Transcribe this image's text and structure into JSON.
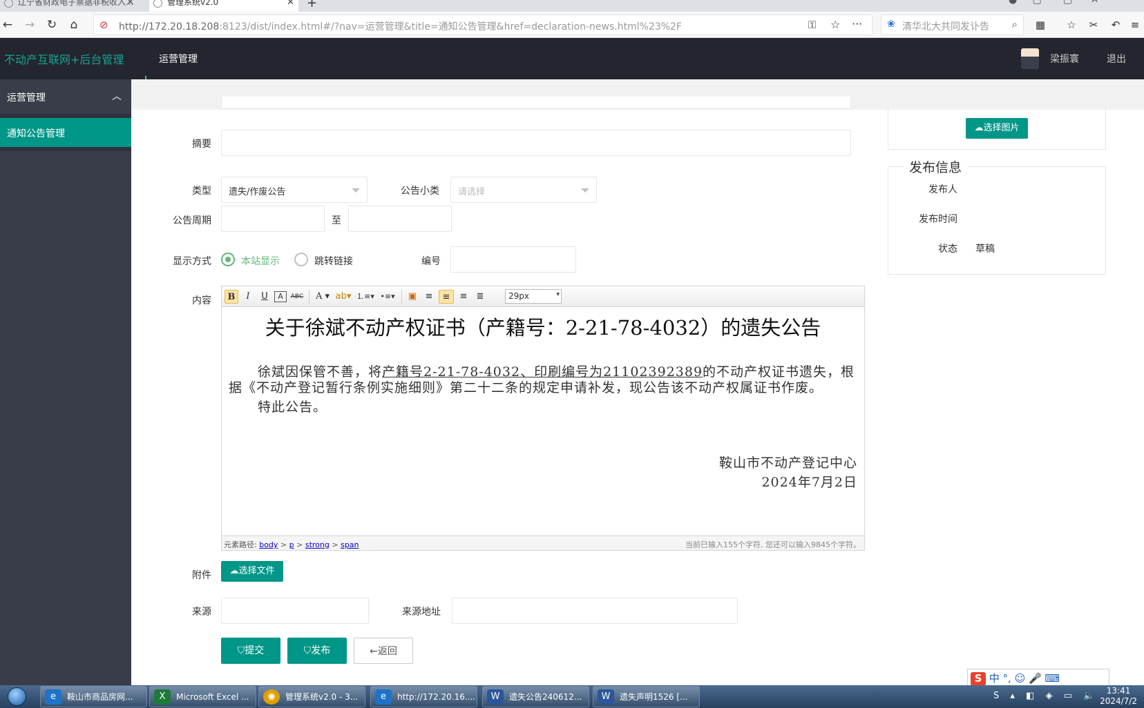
{
  "browser": {
    "tabs": [
      {
        "title": "辽宁省财政电子票据非税收入..."
      },
      {
        "title": "管理系统v2.0"
      }
    ],
    "url_host": "http://172.20.18.208",
    "url_rest": ":8123/dist/index.html#/?nav=运营管理&title=通知公告管理&href=declaration-news.html%23%2F",
    "search_placeholder": "清华北大共同发讣告"
  },
  "header": {
    "brand": "不动产互联网+后台管理",
    "nav": "运营管理",
    "username": "梁振寰",
    "logout": "退出"
  },
  "sidebar": {
    "group": "运营管理",
    "item": "通知公告管理"
  },
  "form": {
    "summary_label": "摘要",
    "type_label": "类型",
    "type_value": "遗失/作废公告",
    "subtype_label": "公告小类",
    "subtype_placeholder": "请选择",
    "period_label": "公告周期",
    "period_to": "至",
    "display_label": "显示方式",
    "display_opt1": "本站显示",
    "display_opt2": "跳转链接",
    "number_label": "编号",
    "content_label": "内容",
    "attachment_label": "附件",
    "attachment_btn": "选择文件",
    "source_label": "来源",
    "source_url_label": "来源地址",
    "submit": "提交",
    "publish": "发布",
    "back": "返回"
  },
  "editor": {
    "font_size": "29px",
    "doc_title": "关于徐斌不动产权证书（产籍号：2-21-78-4032）的遗失公告",
    "para1_a": "徐斌因保管不善，将",
    "para1_u": "产籍号2-21-78-4032、印刷编号为21102392389",
    "para1_b": "的不动产权证书遗失，根",
    "para2": "据《不动产登记暂行条例实施细则》第二十二条的规定申请补发，现公告该不动产权属证书作废。",
    "para3": "特此公告。",
    "signature": "鞍山市不动产登记中心",
    "date": "2024年7月2日",
    "path_label": "元素路径:",
    "path": [
      "body",
      "p",
      "strong",
      "span"
    ],
    "count": "当前已输入155个字符, 您还可以输入9845个字符。"
  },
  "right_panel": {
    "pick_image": "选择图片",
    "legend": "发布信息",
    "publisher_label": "发布人",
    "publish_time_label": "发布时间",
    "status_label": "状态",
    "status_value": "草稿"
  },
  "ime": "中 °, ☺ 🎤 ⌨",
  "taskbar": {
    "items": [
      {
        "label": "鞍山市商品房网..."
      },
      {
        "label": "Microsoft Excel ..."
      },
      {
        "label": "管理系统v2.0 - 3..."
      },
      {
        "label": "http://172.20.16...."
      },
      {
        "label": "遗失公告240612..."
      },
      {
        "label": "遗失声明1526 [..."
      }
    ],
    "time": "13:41",
    "date": "2024/7/2"
  },
  "colors": {
    "primary": "#009688",
    "header": "#23262e",
    "sidebar": "#393d49",
    "radio": "#5fb878"
  }
}
